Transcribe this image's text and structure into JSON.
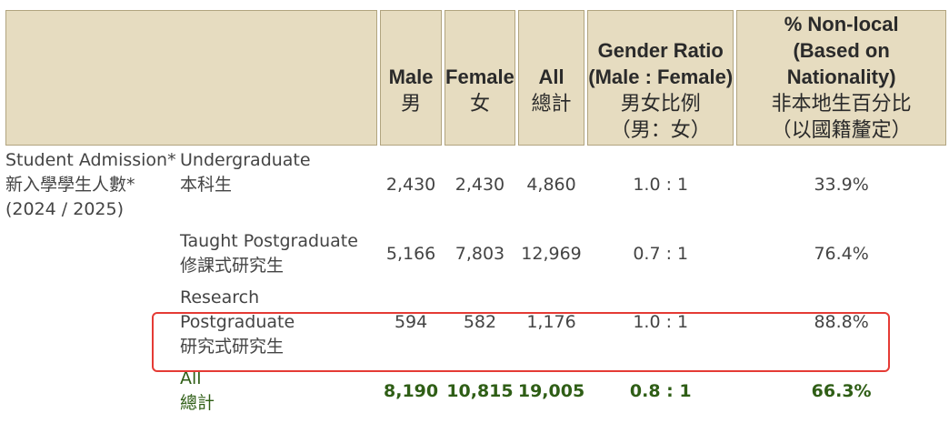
{
  "headers": {
    "male": "Male",
    "male_zh": "男",
    "female": "Female",
    "female_zh": "女",
    "all": "All",
    "all_zh": "總計",
    "ratio": "Gender Ratio",
    "ratio_sub": "(Male : Female)",
    "ratio_zh": "男女比例",
    "ratio_zh_sub": "（男：女）",
    "nonlocal": "% Non-local",
    "nonlocal_sub": "(Based on Nationality)",
    "nonlocal_zh": "非本地生百分比",
    "nonlocal_zh_sub": "（以國籍釐定）"
  },
  "group": {
    "label_en": "Student Admission*",
    "label_zh": "新入學學生人數*",
    "year": "(2024 / 2025)"
  },
  "rows": [
    {
      "type_en": "Undergraduate",
      "type_zh": "本科生",
      "male": "2,430",
      "female": "2,430",
      "all": "4,860",
      "ratio": "1.0 : 1",
      "nonlocal": "33.9%"
    },
    {
      "type_en": "Taught Postgraduate",
      "type_zh": "修課式研究生",
      "male": "5,166",
      "female": "7,803",
      "all": "12,969",
      "ratio": "0.7 : 1",
      "nonlocal": "76.4%"
    },
    {
      "type_en": "Research Postgraduate",
      "type_zh": "研究式研究生",
      "male": "594",
      "female": "582",
      "all": "1,176",
      "ratio": "1.0 : 1",
      "nonlocal": "88.8%"
    }
  ],
  "total": {
    "type_en": "All",
    "type_zh": "總計",
    "male": "8,190",
    "female": "10,815",
    "all": "19,005",
    "ratio": "0.8 : 1",
    "nonlocal": "66.3%"
  },
  "colors": {
    "header_bg": "#e6dcc0",
    "total_text": "#2f5e16",
    "highlight": "#e53b35"
  }
}
